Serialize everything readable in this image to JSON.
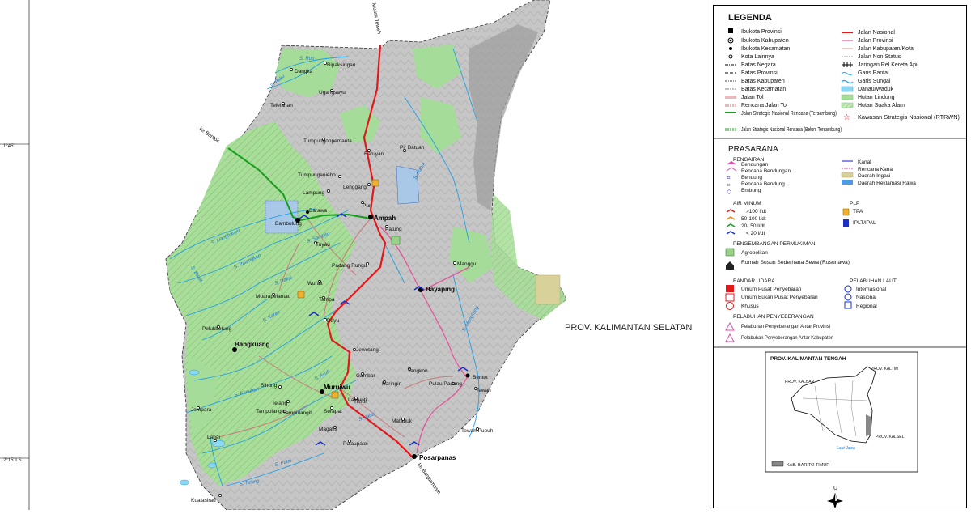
{
  "map": {
    "region_label": "PROV. KALIMANTAN SELATAN",
    "road_label_north": "Muara Teweh",
    "road_label_northwest": "ke Buntok",
    "road_label_south": "ke Banjarmasin",
    "lat_ticks": [
      "1°45'",
      "2°15' LS"
    ],
    "towns_major": [
      "Ampah",
      "Hayaping",
      "Bangkuang",
      "Muruiwu",
      "Posarpanas",
      "Bambulung",
      "Barawa",
      "Bentot"
    ],
    "towns": [
      "Dangka",
      "Bipaksingan",
      "Ugangsayu",
      "Telelanan",
      "Tumpungonpemanta",
      "Baruyan",
      "Pir Batuah",
      "Lenggang",
      "Tumpunganiebo",
      "Lampung",
      "Puri",
      "Tuyau",
      "Patung",
      "Manggu",
      "Padang Rungu",
      "Wurait",
      "Muarapelantau",
      "Tampa",
      "Dayu",
      "Pelukbetung",
      "Jewetang",
      "Tangkon",
      "Haringin",
      "Pulau Padang",
      "Tewah",
      "Gambar",
      "Sihung",
      "Telang",
      "Tampolangit",
      "Tampulangit",
      "Jempara",
      "Lamunti",
      "Serapat",
      "Timur",
      "Matabuk",
      "Tewah Pupuh",
      "Magatis",
      "Pulaupatoi",
      "Lahai",
      "Kualasirau"
    ],
    "rivers": [
      "S. Ruo",
      "S. Paku",
      "S. Lianghanyu",
      "S. Patangkep",
      "S. Dakai",
      "S. Karau",
      "S. Bateh",
      "S. Sampitu",
      "S. Kanuhan",
      "S. Mengkung",
      "S. Ayuh",
      "S. Jabai",
      "S. Patai",
      "S. Telang",
      "S. Nahm"
    ]
  },
  "legend": {
    "title": "LEGENDA",
    "left_items": [
      "Ibukota Provinsi",
      "Ibukota Kabupaten",
      "Ibukota Kecamatan",
      "Kota Lainnya",
      "Batas Negara",
      "Batas Provinsi",
      "Batas Kabupaten",
      "Batas Kecamatan",
      "Jalan Tol",
      "Rencana Jalan Tol",
      "Jalan Strategis Nasional Rencana (Tersambung)",
      "Jalan Strategis Nasional Rencana (Belum Tersambung)"
    ],
    "right_items": [
      "Jalan Nasional",
      "Jalan Provinsi",
      "Jalan Kabupaten/Kota",
      "Jalan Non Status",
      "Jaringan Rel Kereta Api",
      "Garis Pantai",
      "Garis Sungai",
      "Danau/Waduk",
      "Hutan Lindung",
      "Hutan Suaka Alam",
      "Kawasan Strategis Nasional (RTRWN)"
    ],
    "prasarana_title": "PRASARANA",
    "pengairan_title": "PENGAIRAN",
    "pengairan_items": [
      "Bendungan",
      "Rencana Bendungan",
      "Bendung",
      "Rencana Bendung",
      "Embung"
    ],
    "pengairan_right": [
      "Kanal",
      "Rencana Kanal",
      "Daerah Irigasi",
      "Daerah Reklamasi Rawa"
    ],
    "air_minum_title": "AIR MINUM",
    "air_minum_items": [
      ">100 l/dt",
      "50-100 l/dt",
      "20- 50 l/dt",
      "< 20 l/dt"
    ],
    "plp_title": "PLP",
    "plp_items": [
      "TPA",
      "IPLT/IPAL"
    ],
    "permukiman_title": "PENGEMBANGAN PERMUKIMAN",
    "permukiman_items": [
      "Agropolitan",
      "Rumah Susun Sederhana Sewa (Rusunawa)"
    ],
    "bandara_title": "BANDAR UDARA",
    "bandara_items": [
      "Umum Pusat Penyebaran",
      "Umum Bukan Pusat Penyebaran",
      "Khusus"
    ],
    "laut_title": "PELABUHAN LAUT",
    "laut_items": [
      "Internasional",
      "Nasional",
      "Regional"
    ],
    "penyeberangan_title": "PELABUHAN PENYEBERANGAN",
    "penyeberangan_items": [
      "Pelabuhan Penyeberangan Antar Provinsi",
      "Pelabuhan Penyeberangan Antar Kabupaten"
    ]
  },
  "inset": {
    "title": "PROV. KALIMANTAN TENGAH",
    "labels": [
      "PROV. KALTIM",
      "PROV. KALBAR",
      "PROV. KALSEL",
      "Laut Jawa"
    ],
    "legend_label": "KAB. BARITO TIMUR"
  },
  "north_arrow_label": "U",
  "colors": {
    "forest": "#9ed88e",
    "relief": "#c9c9c9",
    "river": "#1fa0e6",
    "national_road": "#e0191b",
    "provincial_road": "#e4569a",
    "district_road": "#c87a7a",
    "strategic_road": "#14a01c"
  }
}
